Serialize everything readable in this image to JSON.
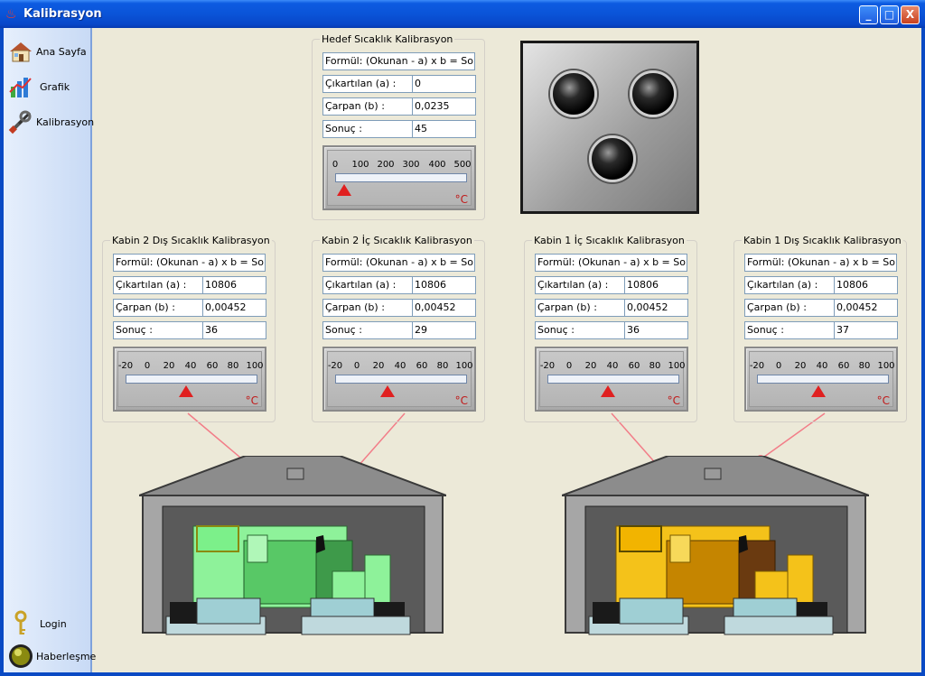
{
  "window": {
    "title": "Kalibrasyon",
    "minimize": "_",
    "maximize": "□",
    "close": "X"
  },
  "sidebar": {
    "items": [
      {
        "label": "Ana Sayfa",
        "icon": "house-icon"
      },
      {
        "label": "Grafik",
        "icon": "chart-icon"
      },
      {
        "label": "Kalibrasyon",
        "icon": "tools-icon"
      }
    ],
    "bottom": [
      {
        "label": "Login",
        "icon": "key-icon"
      },
      {
        "label": "Haberleşme",
        "icon": "status-lamp-icon"
      }
    ]
  },
  "groups": {
    "target": {
      "title": "Hedef Sıcaklık Kalibrasyon",
      "formula": "Formül: (Okunan - a) x b = Sonuç",
      "a_label": "Çıkartılan (a) :",
      "a_value": "0",
      "b_label": "Çarpan (b) :",
      "b_value": "0,0235",
      "r_label": "Sonuç :",
      "r_value": "45",
      "gauge": {
        "ticks": [
          "0",
          "100",
          "200",
          "300",
          "400",
          "500"
        ],
        "unit": "°C"
      }
    },
    "k2_out": {
      "title": "Kabin 2 Dış Sıcaklık Kalibrasyon",
      "formula": "Formül: (Okunan - a) x b = Sonuç",
      "a_label": "Çıkartılan (a) :",
      "a_value": "10806",
      "b_label": "Çarpan (b) :",
      "b_value": "0,00452",
      "r_label": "Sonuç :",
      "r_value": "36",
      "gauge": {
        "ticks": [
          "-20",
          "0",
          "20",
          "40",
          "60",
          "80",
          "100"
        ],
        "unit": "°C"
      }
    },
    "k2_in": {
      "title": "Kabin 2 İç Sıcaklık Kalibrasyon",
      "formula": "Formül: (Okunan - a) x b = Sonuç",
      "a_label": "Çıkartılan (a) :",
      "a_value": "10806",
      "b_label": "Çarpan (b) :",
      "b_value": "0,00452",
      "r_label": "Sonuç :",
      "r_value": "29",
      "gauge": {
        "ticks": [
          "-20",
          "0",
          "20",
          "40",
          "60",
          "80",
          "100"
        ],
        "unit": "°C"
      }
    },
    "k1_in": {
      "title": "Kabin 1 İç Sıcaklık Kalibrasyon",
      "formula": "Formül: (Okunan - a) x b = Sonuç",
      "a_label": "Çıkartılan (a) :",
      "a_value": "10806",
      "b_label": "Çarpan (b) :",
      "b_value": "0,00452",
      "r_label": "Sonuç :",
      "r_value": "36",
      "gauge": {
        "ticks": [
          "-20",
          "0",
          "20",
          "40",
          "60",
          "80",
          "100"
        ],
        "unit": "°C"
      }
    },
    "k1_out": {
      "title": "Kabin 1 Dış Sıcaklık Kalibrasyon",
      "formula": "Formül: (Okunan - a) x b = Sonuç",
      "a_label": "Çıkartılan (a) :",
      "a_value": "10806",
      "b_label": "Çarpan (b) :",
      "b_value": "0,00452",
      "r_label": "Sonuç :",
      "r_value": "37",
      "gauge": {
        "ticks": [
          "-20",
          "0",
          "20",
          "40",
          "60",
          "80",
          "100"
        ],
        "unit": "°C"
      }
    }
  },
  "colors": {
    "generator_cabin2": "#7CF08A",
    "generator_cabin1": "#F2B400",
    "sensor_dot": "#F27D88"
  }
}
